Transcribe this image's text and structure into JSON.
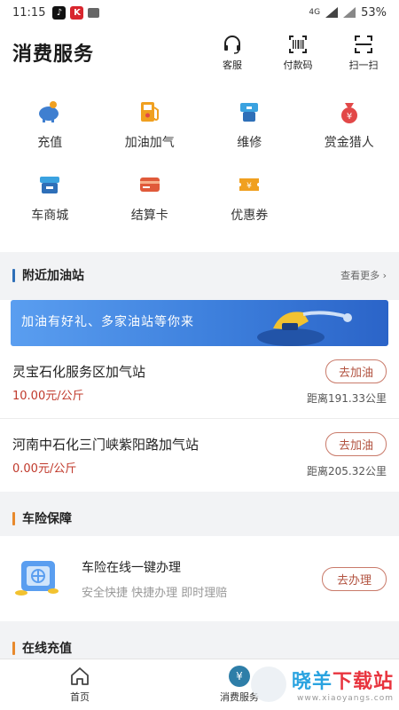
{
  "status_bar": {
    "time": "11:15",
    "network": "4G",
    "battery": "53%",
    "app_badge": "K"
  },
  "header": {
    "title": "消费服务",
    "actions": [
      {
        "label": "客服",
        "icon": "headset-icon"
      },
      {
        "label": "付款码",
        "icon": "barcode-icon"
      },
      {
        "label": "扫一扫",
        "icon": "scan-icon"
      }
    ]
  },
  "services": [
    {
      "label": "充值",
      "icon": "piggy-bank-icon",
      "color": "#3f7fd0"
    },
    {
      "label": "加油加气",
      "icon": "fuel-pump-icon",
      "color": "#f0a020"
    },
    {
      "label": "维修",
      "icon": "tool-icon",
      "color": "#3aa2e0"
    },
    {
      "label": "赏金猎人",
      "icon": "money-bag-icon",
      "color": "#e24848"
    },
    {
      "label": "车商城",
      "icon": "shop-icon",
      "color": "#3aa2e0"
    },
    {
      "label": "结算卡",
      "icon": "card-icon",
      "color": "#e05a3a"
    },
    {
      "label": "优惠券",
      "icon": "coupon-icon",
      "color": "#f0a020"
    }
  ],
  "nearby": {
    "title": "附近加油站",
    "more": "查看更多 ›",
    "banner_text": "加油有好礼、多家油站等你来",
    "stations": [
      {
        "name": "灵宝石化服务区加气站",
        "price": "10.00元/公斤",
        "button": "去加油",
        "distance": "距离191.33公里"
      },
      {
        "name": "河南中石化三门峡紫阳路加气站",
        "price": "0.00元/公斤",
        "button": "去加油",
        "distance": "距离205.32公里"
      }
    ]
  },
  "insurance": {
    "title": "车险保障",
    "headline": "车险在线一键办理",
    "tags": "安全快捷  快捷办理  即时理赔",
    "button": "去办理"
  },
  "recharge": {
    "title": "在线充值"
  },
  "tabbar": {
    "tabs": [
      {
        "label": "首页",
        "icon": "home-icon"
      },
      {
        "label": "消费服务",
        "icon": "yuan-icon",
        "glyph": "¥"
      }
    ]
  },
  "watermark": {
    "part1": "晓羊",
    "part2": "下载站",
    "url": "www.xiaoyangs.com"
  },
  "colors": {
    "blue_bar": "#2e6fb8",
    "orange_bar": "#e8892c",
    "accent_red": "#c0392b",
    "tab_active": "#2e7ea8"
  }
}
